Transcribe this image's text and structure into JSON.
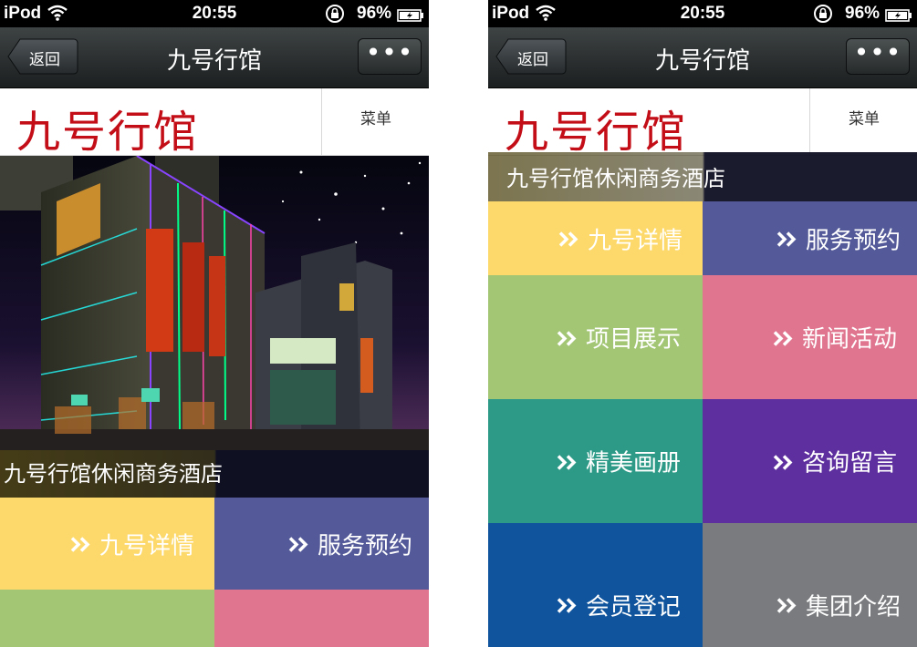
{
  "status_bar": {
    "carrier": "iPod",
    "time": "20:55",
    "battery": "96%"
  },
  "nav": {
    "back_label": "返回",
    "title": "九号行馆",
    "more_label": "•••"
  },
  "header": {
    "logo": "九号行馆",
    "menu_label": "菜单"
  },
  "caption": "九号行馆休闲商务酒店",
  "tiles": [
    {
      "label": "九号详情",
      "color": "#fcd96a"
    },
    {
      "label": "服务预约",
      "color": "#545a99"
    },
    {
      "label": "项目展示",
      "color": "#a3c675"
    },
    {
      "label": "新闻活动",
      "color": "#e0758f"
    },
    {
      "label": "精美画册",
      "color": "#2c9a86"
    },
    {
      "label": "咨询留言",
      "color": "#5e2f9f"
    },
    {
      "label": "会员登记",
      "color": "#0f549c"
    },
    {
      "label": "集团介绍",
      "color": "#797b7e"
    }
  ]
}
